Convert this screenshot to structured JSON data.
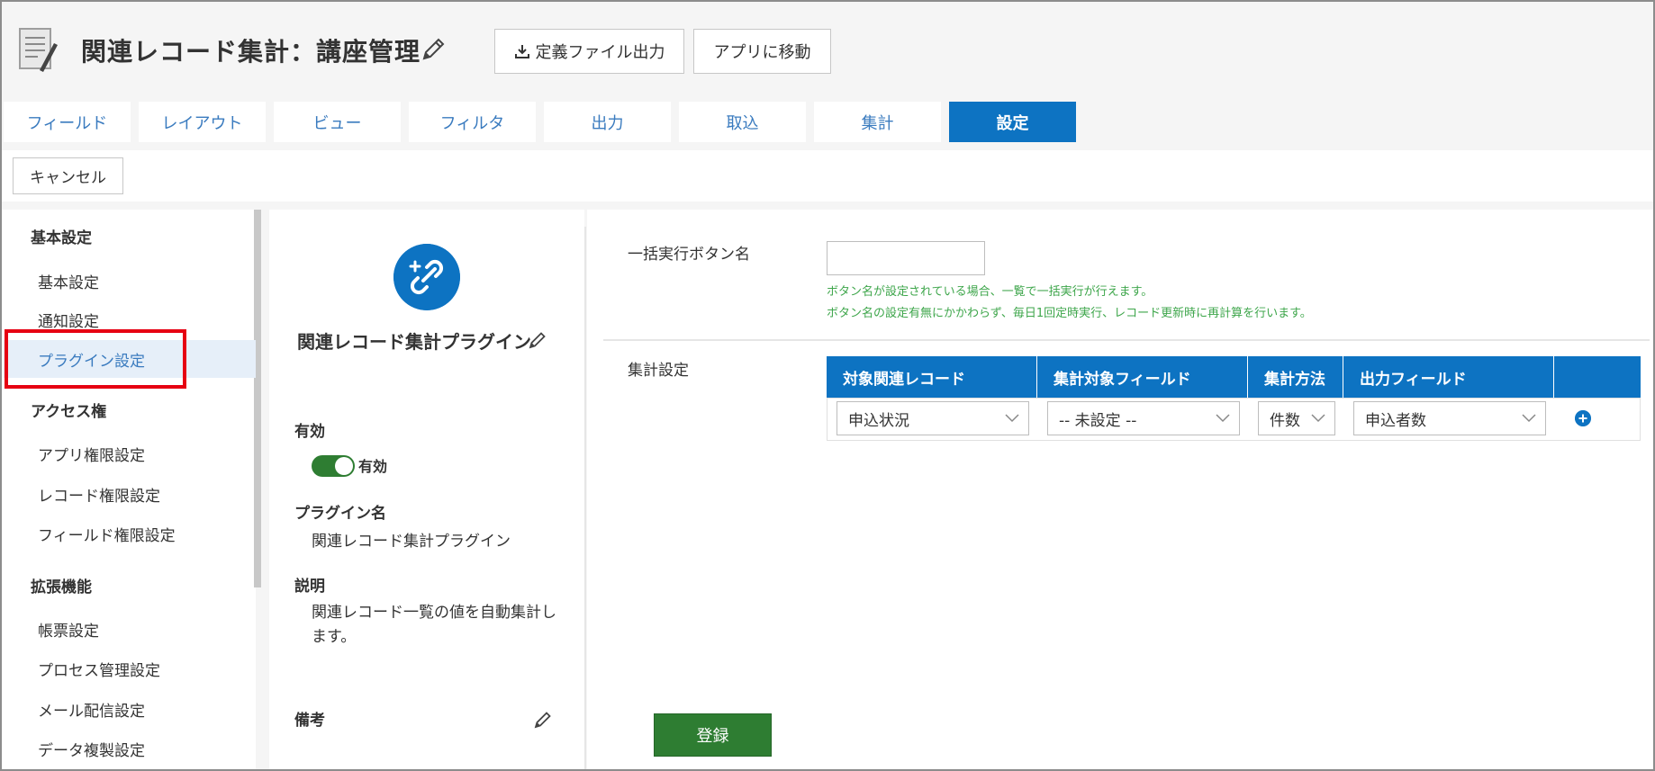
{
  "header": {
    "title": "関連レコード集計：講座管理",
    "export_label": "定義ファイル出力",
    "open_app_label": "アプリに移動"
  },
  "tabs": [
    {
      "label": "フィールド"
    },
    {
      "label": "レイアウト"
    },
    {
      "label": "ビュー"
    },
    {
      "label": "フィルタ"
    },
    {
      "label": "出力"
    },
    {
      "label": "取込"
    },
    {
      "label": "集計"
    },
    {
      "label": "設定",
      "active": true
    }
  ],
  "toolbar": {
    "cancel_label": "キャンセル"
  },
  "sidebar": {
    "sections": [
      {
        "heading": "基本設定",
        "items": [
          "基本設定",
          "通知設定",
          "プラグイン設定"
        ]
      },
      {
        "heading": "アクセス権",
        "items": [
          "アプリ権限設定",
          "レコード権限設定",
          "フィールド権限設定"
        ]
      },
      {
        "heading": "拡張機能",
        "items": [
          "帳票設定",
          "プロセス管理設定",
          "メール配信設定",
          "データ複製設定"
        ]
      }
    ],
    "active_item": "プラグイン設定"
  },
  "plugin": {
    "name": "関連レコード集計プラグイン",
    "enabled_heading": "有効",
    "enabled_toggle_label": "有効",
    "enabled": true,
    "plugin_name_heading": "プラグイン名",
    "plugin_name_value": "関連レコード集計プラグイン",
    "description_heading": "説明",
    "description_line1": "関連レコード一覧の値を自動集計し",
    "description_line2": "ます。",
    "remarks_heading": "備考"
  },
  "settings": {
    "batch_button_label": "一括実行ボタン名",
    "batch_button_value": "",
    "hint1": "ボタン名が設定されている場合、一覧で一括実行が行えます。",
    "hint2": "ボタン名の設定有無にかかわらず、毎日1回定時実行、レコード更新時に再計算を行います。",
    "aggregation_label": "集計設定",
    "table_headers": [
      "対象関連レコード",
      "集計対象フィールド",
      "集計方法",
      "出力フィールド"
    ],
    "row": {
      "related_record": "申込状況",
      "target_field": "-- 未設定 --",
      "method": "件数",
      "output_field": "申込者数"
    },
    "save_label": "登録"
  },
  "colors": {
    "accent": "#0d73c2",
    "success": "#2e7d32",
    "hint": "#3ea64b",
    "highlight": "#e60012"
  }
}
